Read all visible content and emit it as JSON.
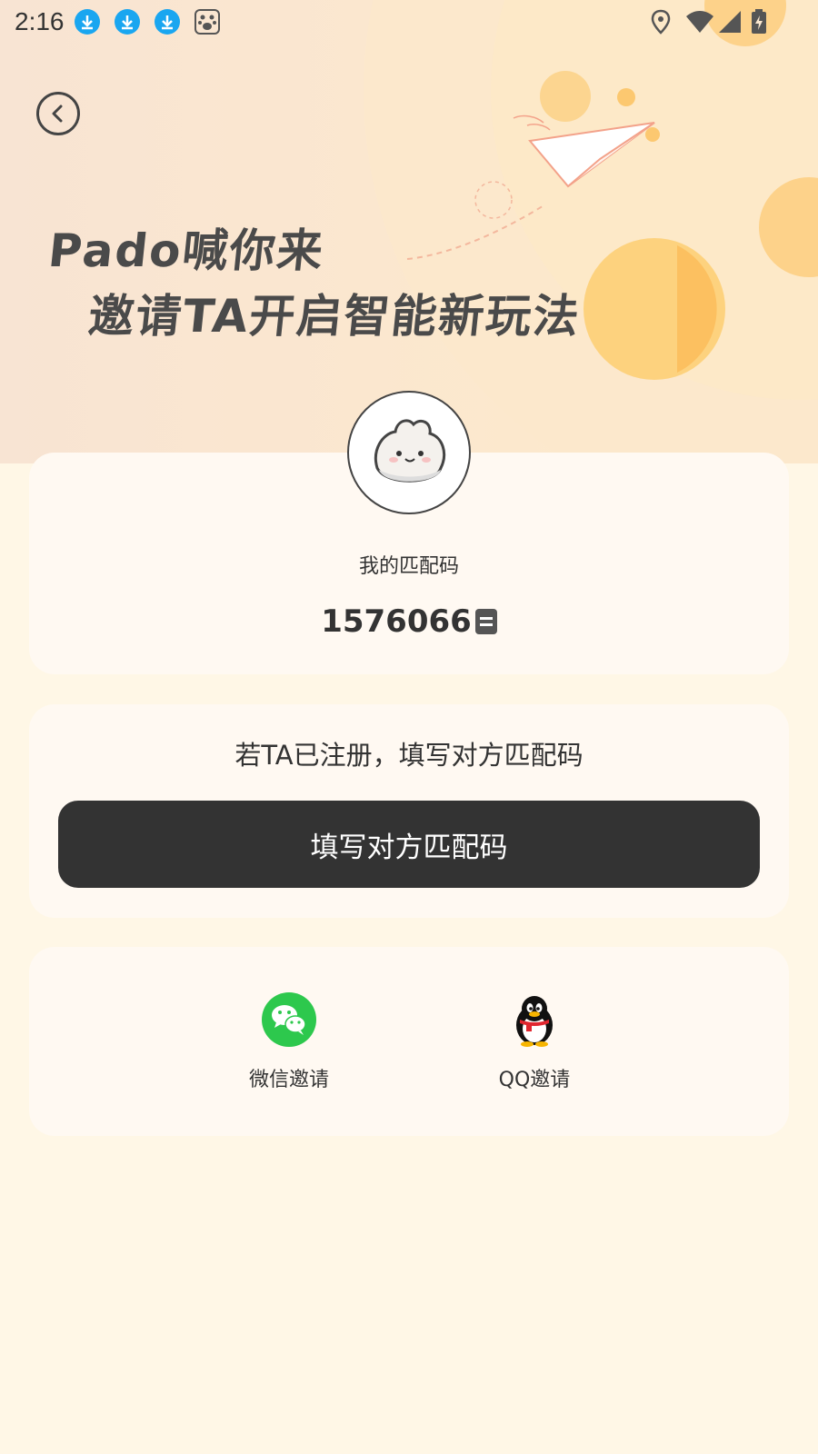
{
  "status_bar": {
    "time": "2:16",
    "notification_icons": [
      "download-icon",
      "download-icon",
      "download-icon",
      "baidu-icon"
    ],
    "right_icons": [
      "location-icon",
      "wifi-icon",
      "signal-icon",
      "battery-charging-icon"
    ]
  },
  "header": {
    "headline_line1": "Pado喊你来",
    "headline_line2": "邀请TA开启智能新玩法"
  },
  "my_code": {
    "label": "我的匹配码",
    "value": "1576066"
  },
  "partner": {
    "hint": "若TA已注册，填写对方匹配码",
    "button_label": "填写对方匹配码"
  },
  "share": {
    "wechat_label": "微信邀请",
    "qq_label": "QQ邀请"
  },
  "colors": {
    "background": "#fff7e6",
    "card": "#fff9f2",
    "button": "#333333",
    "wechat": "#2dc84d",
    "notif_blue": "#1aa6f0"
  }
}
